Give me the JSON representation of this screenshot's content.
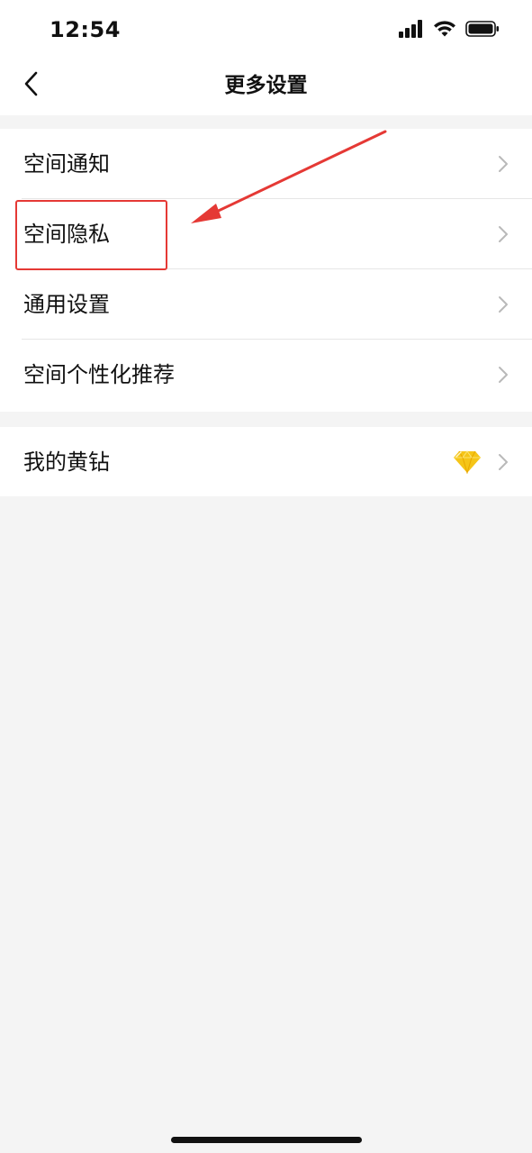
{
  "status_bar": {
    "time": "12:54"
  },
  "nav": {
    "title": "更多设置"
  },
  "settings": {
    "group_1": [
      {
        "label": "空间通知"
      },
      {
        "label": "空间隐私"
      },
      {
        "label": "通用设置"
      },
      {
        "label": "空间个性化推荐"
      }
    ],
    "group_2": [
      {
        "label": "我的黄钻",
        "icon": "yellow-diamond-icon"
      }
    ]
  },
  "annotation": {
    "highlight_target": "空间隐私",
    "color": "#e53935"
  },
  "colors": {
    "background": "#f4f4f4",
    "surface": "#ffffff",
    "divider": "#e6e6e6",
    "chevron": "#b9b9b9",
    "diamond": "#f5c518"
  }
}
